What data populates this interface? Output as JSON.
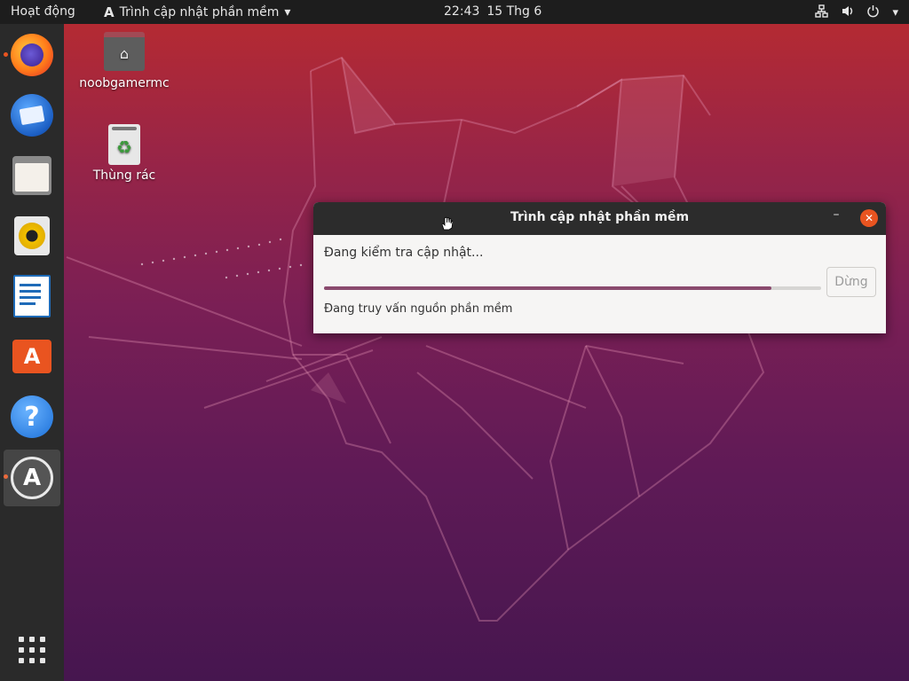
{
  "topbar": {
    "activities": "Hoạt động",
    "app_name": "Trình cập nhật phần mềm",
    "app_icon": "software-updater-icon",
    "time": "22:43",
    "date": "15 Thg 6"
  },
  "dock": {
    "items": [
      {
        "name": "firefox",
        "icon": "firefox-icon",
        "running": true
      },
      {
        "name": "thunderbird",
        "icon": "thunderbird-icon",
        "running": false
      },
      {
        "name": "files",
        "icon": "files-icon",
        "running": false
      },
      {
        "name": "rhythmbox",
        "icon": "rhythmbox-icon",
        "running": false
      },
      {
        "name": "libreoffice-writer",
        "icon": "writer-icon",
        "running": false
      },
      {
        "name": "ubuntu-software",
        "icon": "software-icon",
        "running": false
      },
      {
        "name": "help",
        "icon": "help-icon",
        "running": false
      },
      {
        "name": "software-updater",
        "icon": "software-updater-icon",
        "running": true
      }
    ],
    "show_apps_icon": "grid-icon"
  },
  "desktop": {
    "home_label": "noobgamermc",
    "trash_label": "Thùng rác"
  },
  "dialog": {
    "title": "Trình cập nhật phần mềm",
    "status": "Đang kiểm tra cập nhật...",
    "progress": 0.9,
    "stop_label": "Dừng",
    "substatus": "Đang truy vấn nguồn phần mềm"
  },
  "colors": {
    "accent": "#e95420",
    "topbar": "#1d1d1d",
    "dock": "#2a2a2a",
    "progress": "#8a4a6e"
  }
}
